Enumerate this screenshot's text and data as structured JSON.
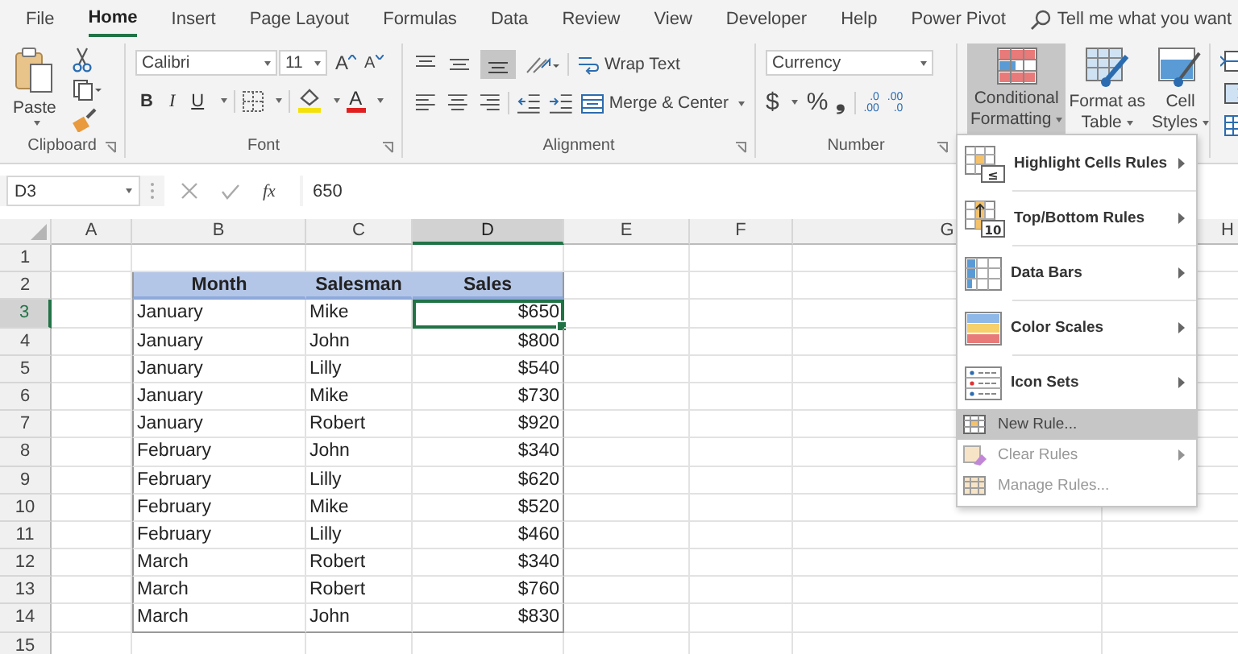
{
  "menu_tabs": [
    {
      "label": "File",
      "selected": false
    },
    {
      "label": "Home",
      "selected": true
    },
    {
      "label": "Insert",
      "selected": false
    },
    {
      "label": "Page Layout",
      "selected": false
    },
    {
      "label": "Formulas",
      "selected": false
    },
    {
      "label": "Data",
      "selected": false
    },
    {
      "label": "Review",
      "selected": false
    },
    {
      "label": "View",
      "selected": false
    },
    {
      "label": "Developer",
      "selected": false
    },
    {
      "label": "Help",
      "selected": false
    },
    {
      "label": "Power Pivot",
      "selected": false
    }
  ],
  "tell_me": {
    "placeholder": "Tell me what you want"
  },
  "ribbon": {
    "clipboard": {
      "label": "Clipboard",
      "paste": "Paste"
    },
    "font": {
      "label": "Font",
      "name": "Calibri",
      "size": "11",
      "grow": "A",
      "shrink": "A",
      "bold": "B",
      "italic": "I",
      "underline": "U",
      "font_color": "A"
    },
    "alignment": {
      "label": "Alignment",
      "wrap_text": "Wrap Text",
      "merge": "Merge & Center"
    },
    "number": {
      "label": "Number",
      "format": "Currency",
      "currency": "$",
      "percent": "%",
      "comma": "❟",
      "increase_decimal": [
        ".0",
        ".00"
      ],
      "decrease_decimal": [
        ".00",
        ".0"
      ]
    },
    "styles": [
      {
        "kind": "conditional",
        "lines": [
          "Conditional",
          "Formatting"
        ],
        "selected": true
      },
      {
        "kind": "table",
        "lines": [
          "Format as",
          "Table"
        ],
        "selected": false
      },
      {
        "kind": "cell",
        "lines": [
          "Cell",
          "Styles"
        ],
        "selected": false
      }
    ]
  },
  "formula_bar": {
    "name_box": "D3",
    "fx": "fx",
    "value": "650"
  },
  "sheet": {
    "columns": [
      {
        "label": "A",
        "selected": false
      },
      {
        "label": "B",
        "selected": false
      },
      {
        "label": "C",
        "selected": false
      },
      {
        "label": "D",
        "selected": true
      },
      {
        "label": "E",
        "selected": false
      },
      {
        "label": "F",
        "selected": false
      },
      {
        "label": "G",
        "selected": false
      },
      {
        "label": "H",
        "selected": false
      }
    ],
    "rows": [
      {
        "number": "1",
        "selected": false,
        "kind": "empty"
      },
      {
        "number": "2",
        "selected": false,
        "kind": "header",
        "cells": [
          "Month",
          "Salesman",
          "Sales"
        ]
      },
      {
        "number": "3",
        "selected": true,
        "kind": "data",
        "cells": [
          "January",
          "Mike",
          "$650"
        ],
        "active": true
      },
      {
        "number": "4",
        "selected": false,
        "kind": "data",
        "cells": [
          "January",
          "John",
          "$800"
        ],
        "active": false
      },
      {
        "number": "5",
        "selected": false,
        "kind": "data",
        "cells": [
          "January",
          "Lilly",
          "$540"
        ],
        "active": false
      },
      {
        "number": "6",
        "selected": false,
        "kind": "data",
        "cells": [
          "January",
          "Mike",
          "$730"
        ],
        "active": false
      },
      {
        "number": "7",
        "selected": false,
        "kind": "data",
        "cells": [
          "January",
          "Robert",
          "$920"
        ],
        "active": false
      },
      {
        "number": "8",
        "selected": false,
        "kind": "data",
        "cells": [
          "February",
          "John",
          "$340"
        ],
        "active": false
      },
      {
        "number": "9",
        "selected": false,
        "kind": "data",
        "cells": [
          "February",
          "Lilly",
          "$620"
        ],
        "active": false
      },
      {
        "number": "10",
        "selected": false,
        "kind": "data",
        "cells": [
          "February",
          "Mike",
          "$520"
        ],
        "active": false
      },
      {
        "number": "11",
        "selected": false,
        "kind": "data",
        "cells": [
          "February",
          "Lilly",
          "$460"
        ],
        "active": false
      },
      {
        "number": "12",
        "selected": false,
        "kind": "data",
        "cells": [
          "March",
          "Robert",
          "$340"
        ],
        "active": false
      },
      {
        "number": "13",
        "selected": false,
        "kind": "data",
        "cells": [
          "March",
          "Robert",
          "$760"
        ],
        "active": false
      },
      {
        "number": "14",
        "selected": false,
        "kind": "data",
        "cells": [
          "March",
          "John",
          "$830"
        ],
        "active": false
      },
      {
        "number": "15",
        "selected": false,
        "kind": "empty"
      }
    ]
  },
  "cf_menu": {
    "items": [
      {
        "kind": "large",
        "icon_text": "≤",
        "label": "Highlight Cells Rules",
        "submenu": true,
        "selected": false,
        "disabled": false
      },
      {
        "kind": "large",
        "icon_text": "10",
        "label": "Top/Bottom Rules",
        "submenu": true,
        "selected": false,
        "disabled": false
      },
      {
        "kind": "large",
        "label": "Data Bars",
        "submenu": true,
        "selected": false,
        "disabled": false
      },
      {
        "kind": "large",
        "label": "Color Scales",
        "submenu": true,
        "selected": false,
        "disabled": false
      },
      {
        "kind": "large",
        "label": "Icon Sets",
        "submenu": true,
        "selected": false,
        "disabled": false
      },
      {
        "kind": "small",
        "label": "New Rule...",
        "submenu": false,
        "selected": true,
        "disabled": false
      },
      {
        "kind": "small",
        "label": "Clear Rules",
        "submenu": true,
        "selected": false,
        "disabled": true
      },
      {
        "kind": "small",
        "label": "Manage Rules...",
        "submenu": false,
        "selected": false,
        "disabled": true
      }
    ]
  }
}
